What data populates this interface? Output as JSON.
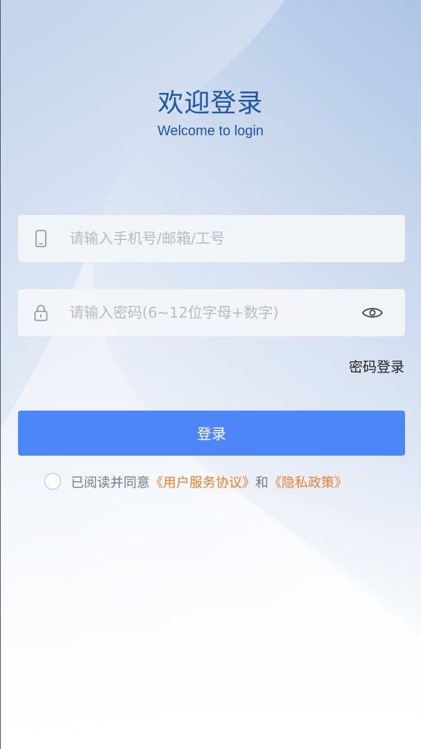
{
  "header": {
    "title": "欢迎登录",
    "subtitle": "Welcome to login"
  },
  "account_field": {
    "placeholder": "请输入手机号/邮箱/工号",
    "icon": "phone-icon"
  },
  "password_field": {
    "placeholder": "请输入密码(6~12位字母+数字)",
    "icon": "lock-icon",
    "toggle_icon": "eye-icon"
  },
  "switch_login_mode": "密码登录",
  "login_button": "登录",
  "agreement": {
    "prefix": "已阅读并同意",
    "user_agreement": "《用户服务协议》",
    "conjunction": "和",
    "privacy_policy": "《隐私政策》"
  },
  "colors": {
    "title": "#1e55a6",
    "primary_button": "#4f86f7",
    "link": "#f08030",
    "placeholder": "#b7bcc4"
  }
}
